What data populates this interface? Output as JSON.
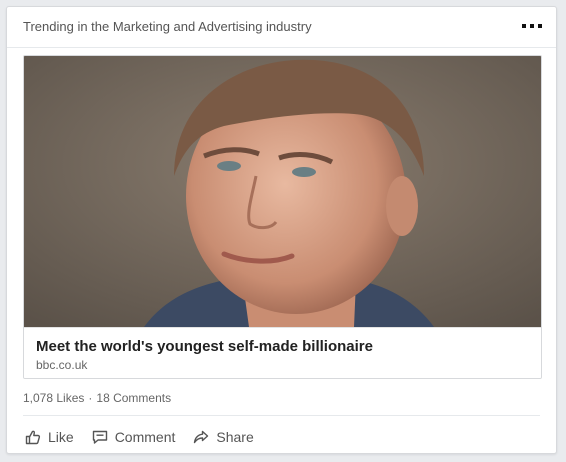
{
  "card": {
    "header_title": "Trending in the Marketing and Advertising industry",
    "overflow_icon": "more-horizontal-icon"
  },
  "article": {
    "image_alt": "portrait-photo",
    "title": "Meet the world's youngest self-made billionaire",
    "source": "bbc.co.uk"
  },
  "stats": {
    "likes": "1,078 Likes",
    "separator": "·",
    "comments": "18 Comments"
  },
  "actions": {
    "like": {
      "label": "Like",
      "icon": "thumbs-up-icon"
    },
    "comment": {
      "label": "Comment",
      "icon": "comment-icon"
    },
    "share": {
      "label": "Share",
      "icon": "share-icon"
    }
  },
  "colors": {
    "background": "#e9ebee",
    "card": "#ffffff",
    "border": "#d7d9dc",
    "text_primary": "#222222",
    "text_secondary": "#666666"
  }
}
